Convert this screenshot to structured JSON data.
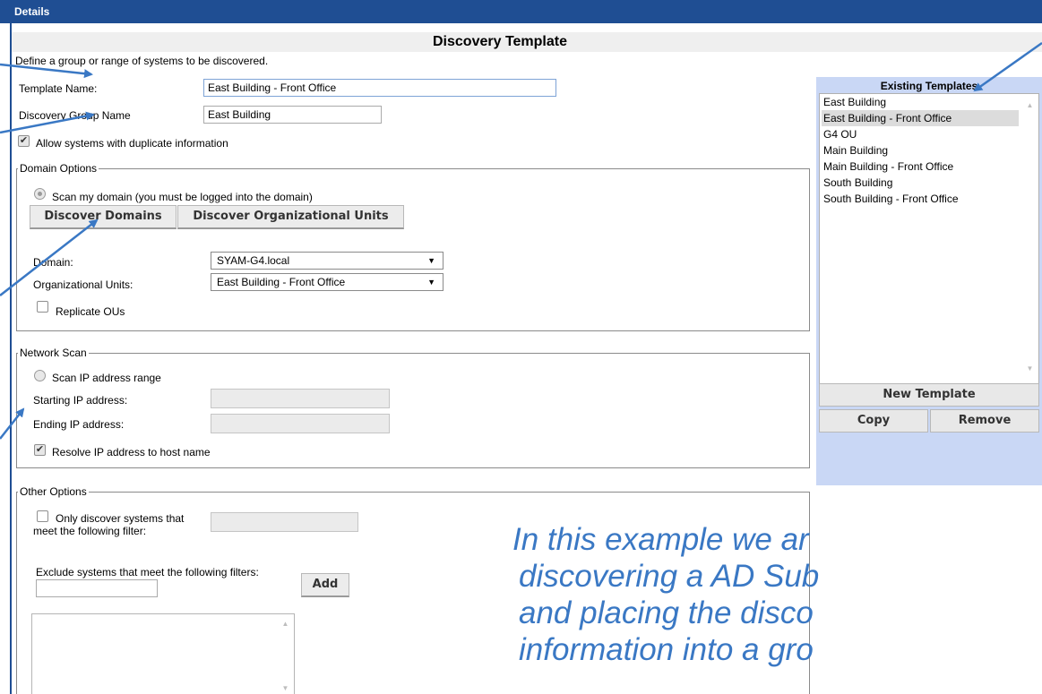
{
  "window": {
    "title": "Details"
  },
  "header": {
    "title": "Discovery Template"
  },
  "intro": "Define a group or range of systems to be discovered.",
  "template_name": {
    "label": "Template Name:",
    "value": "East Building - Front Office"
  },
  "group_name": {
    "label": "Discovery Group Name",
    "value": "East Building"
  },
  "allow_duplicates": {
    "label": "Allow systems with duplicate information",
    "checked": true
  },
  "domain_options": {
    "legend": "Domain Options",
    "scan_domain_label": "Scan my domain (you must be logged into the domain)",
    "discover_domains": "Discover Domains",
    "discover_ous": "Discover Organizational Units",
    "domain_label": "Domain:",
    "domain_value": "SYAM-G4.local",
    "ou_label": "Organizational Units:",
    "ou_value": "East Building - Front Office",
    "replicate_label": "Replicate OUs"
  },
  "network_scan": {
    "legend": "Network Scan",
    "scan_range_label": "Scan IP address range",
    "start_label": "Starting IP address:",
    "end_label": "Ending IP address:",
    "resolve_label": "Resolve IP address to host name"
  },
  "other_options": {
    "legend": "Other Options",
    "only_filter_label_1": "Only discover systems that",
    "only_filter_label_2": "meet the following filter:",
    "exclude_label": "Exclude systems that meet the following filters:",
    "add_button": "Add"
  },
  "existing_templates": {
    "title": "Existing Templates",
    "items": [
      "East Building",
      "East Building - Front Office",
      "G4 OU",
      "Main Building",
      "Main Building - Front Office",
      "South Building",
      "South Building - Front Office"
    ],
    "selected": "East Building - Front Office",
    "new_button": "New Template",
    "copy_button": "Copy",
    "remove_button": "Remove"
  },
  "overlay_text": {
    "line1": "In this example we ar",
    "line2": "discovering a AD Sub",
    "line3": "and placing the disco",
    "line4": "information into a gro"
  },
  "colors": {
    "titlebar": "#1f4e93",
    "panel": "#c9d7f5",
    "annotation": "#3a78c4"
  }
}
